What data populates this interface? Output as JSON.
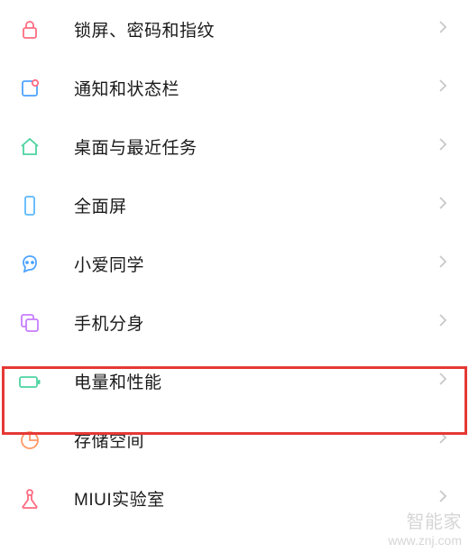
{
  "settings": {
    "items": [
      {
        "id": "lock",
        "label": "锁屏、密码和指纹",
        "icon": "lock-icon",
        "color": "#ff6b81"
      },
      {
        "id": "notification",
        "label": "通知和状态栏",
        "icon": "notification-icon",
        "color": "#4da3ff"
      },
      {
        "id": "desktop",
        "label": "桌面与最近任务",
        "icon": "home-icon",
        "color": "#4dd4a0"
      },
      {
        "id": "fullscreen",
        "label": "全面屏",
        "icon": "phone-icon",
        "color": "#5bb8ff"
      },
      {
        "id": "xiaoai",
        "label": "小爱同学",
        "icon": "xiaoai-icon",
        "color": "#4da3ff"
      },
      {
        "id": "clone",
        "label": "手机分身",
        "icon": "clone-icon",
        "color": "#c77dff"
      },
      {
        "id": "battery",
        "label": "电量和性能",
        "icon": "battery-icon",
        "color": "#4dd4a0",
        "highlighted": true
      },
      {
        "id": "storage",
        "label": "存储空间",
        "icon": "storage-icon",
        "color": "#ff9966"
      },
      {
        "id": "lab",
        "label": "MIUI实验室",
        "icon": "lab-icon",
        "color": "#ff6b81"
      }
    ]
  },
  "watermark": {
    "line1": "智能家",
    "line2": "www.znj.com"
  }
}
